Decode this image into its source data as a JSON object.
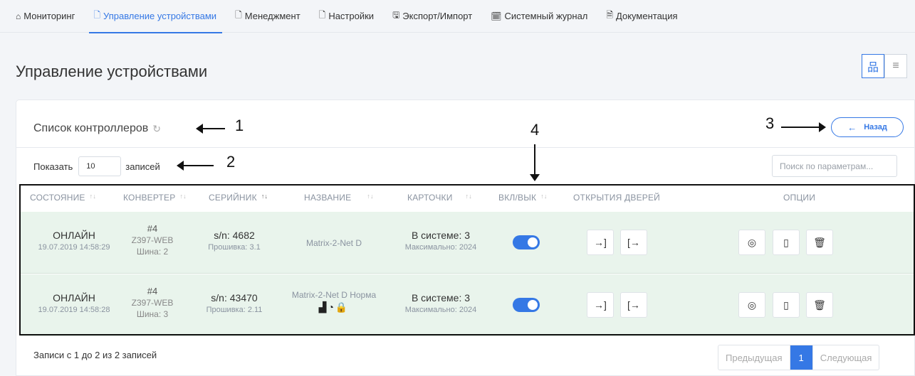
{
  "nav": [
    {
      "icon": "⌂",
      "label": "Мониторинг",
      "active": false
    },
    {
      "icon": "🗋",
      "label": "Управление устройствами",
      "active": true
    },
    {
      "icon": "🗋",
      "label": "Менеджмент",
      "active": false
    },
    {
      "icon": "🗋",
      "label": "Настройки",
      "active": false
    },
    {
      "icon": "🖫",
      "label": "Экспорт/Импорт",
      "active": false
    },
    {
      "icon": "🗓",
      "label": "Системный журнал",
      "active": false
    },
    {
      "icon": "🗎",
      "label": "Документация",
      "active": false
    }
  ],
  "page_title": "Управление устройствами",
  "card_title": "Список контроллеров",
  "back_button": "Назад",
  "show": {
    "prefix": "Показать",
    "value": "10",
    "suffix": "записей"
  },
  "search_placeholder": "Поиск по параметрам...",
  "columns": [
    "СОСТОЯНИЕ",
    "КОНВЕРТЕР",
    "СЕРИЙНИК",
    "НАЗВАНИЕ",
    "КАРТОЧКИ",
    "ВКЛ/ВЫК",
    "ОТКРЫТИЯ ДВЕРЕЙ",
    "ОПЦИИ"
  ],
  "rows": [
    {
      "state": "ОНЛАЙН",
      "datetime": "19.07.2019 14:58:29",
      "conv_num": "#4",
      "conv_model": "Z397-WEB",
      "conv_bus": "Шина: 2",
      "serial": "s/n: 4682",
      "firmware": "Прошивка: 3.1",
      "name": "Matrix-2-Net D",
      "name_icons": "",
      "cards_in": "В системе: 3",
      "cards_max": "Максимально: 2024",
      "enabled": true
    },
    {
      "state": "ОНЛАЙН",
      "datetime": "19.07.2019 14:58:28",
      "conv_num": "#4",
      "conv_model": "Z397-WEB",
      "conv_bus": "Шина: 3",
      "serial": "s/n: 43470",
      "firmware": "Прошивка: 2.11",
      "name": "Matrix-2-Net D Норма",
      "name_icons": "▟◔🔒",
      "cards_in": "В системе: 3",
      "cards_max": "Максимально: 2024",
      "enabled": true
    }
  ],
  "summary": "Записи с 1 до 2 из 2 записей",
  "pager": {
    "prev": "Предыдущая",
    "current": "1",
    "next": "Следующая"
  },
  "annotations": {
    "a1": "1",
    "a2": "2",
    "a3": "3",
    "a4": "4"
  },
  "icons": {
    "refresh": "↻",
    "back_arrow": "←",
    "tree_view": "品",
    "list_view": "≡",
    "enter": "→]",
    "exit": "[→",
    "view": "◎",
    "clipboard": "▯",
    "delete": "🗑"
  },
  "colors": {
    "accent": "#3578e5",
    "row_bg": "#e9f4ec"
  }
}
